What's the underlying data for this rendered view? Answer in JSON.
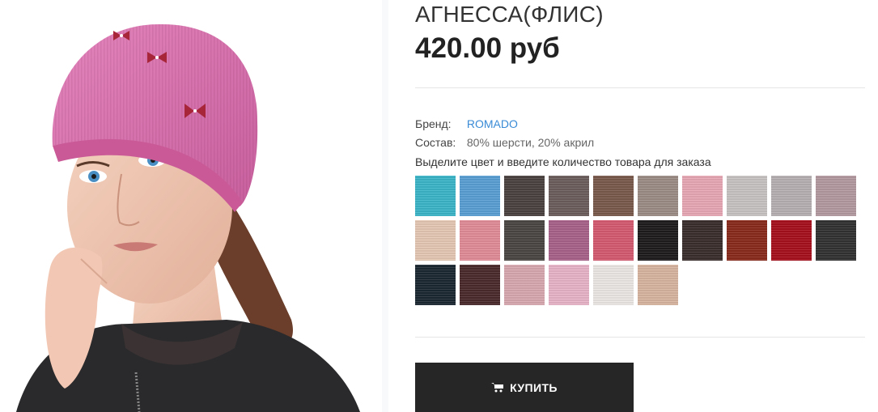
{
  "product": {
    "title": "АГНЕССА(ФЛИС)",
    "price": "420.00 руб",
    "brand_label": "Бренд:",
    "brand_value": "ROMADO",
    "composition_label": "Состав:",
    "composition_value": "80% шерсти, 20% акрил",
    "color_hint": "Выделите цвет и введите количество товара для заказа"
  },
  "swatches": [
    {
      "color": "#3bb6c9",
      "icon": "color-swatch"
    },
    {
      "color": "#5a9fd4",
      "icon": "color-swatch"
    },
    {
      "color": "#4a4240",
      "icon": "color-swatch"
    },
    {
      "color": "#6b5e5c",
      "icon": "color-swatch"
    },
    {
      "color": "#7a5a4c",
      "icon": "color-swatch"
    },
    {
      "color": "#9c8c86",
      "icon": "color-swatch"
    },
    {
      "color": "#e8a8b6",
      "icon": "color-swatch"
    },
    {
      "color": "#c9c3c3",
      "icon": "color-swatch"
    },
    {
      "color": "#b8b0b2",
      "icon": "color-swatch"
    },
    {
      "color": "#b49aa2",
      "icon": "color-swatch"
    },
    {
      "color": "#e6c8b4",
      "icon": "color-swatch"
    },
    {
      "color": "#e08c98",
      "icon": "color-swatch"
    },
    {
      "color": "#4a4644",
      "icon": "color-swatch"
    },
    {
      "color": "#a8628a",
      "icon": "color-swatch"
    },
    {
      "color": "#d45a70",
      "icon": "color-swatch"
    },
    {
      "color": "#1e1c1c",
      "icon": "color-swatch"
    },
    {
      "color": "#3a2e2c",
      "icon": "color-swatch"
    },
    {
      "color": "#8a2a1c",
      "icon": "color-swatch"
    },
    {
      "color": "#a8101e",
      "icon": "color-swatch"
    },
    {
      "color": "#323232",
      "icon": "color-swatch"
    },
    {
      "color": "#1c2832",
      "icon": "color-swatch"
    },
    {
      "color": "#4a2a2c",
      "icon": "color-swatch"
    },
    {
      "color": "#d8a8b0",
      "icon": "color-swatch"
    },
    {
      "color": "#e8b4c8",
      "icon": "color-swatch"
    },
    {
      "color": "#ece8e6",
      "icon": "color-swatch"
    },
    {
      "color": "#d8b6a0",
      "icon": "color-swatch"
    }
  ],
  "buy_button": {
    "label": "КУПИТЬ",
    "icon": "cart-icon",
    "background": "#262626"
  },
  "colors": {
    "link": "#3a8bd6",
    "divider": "#e6e6e6"
  }
}
